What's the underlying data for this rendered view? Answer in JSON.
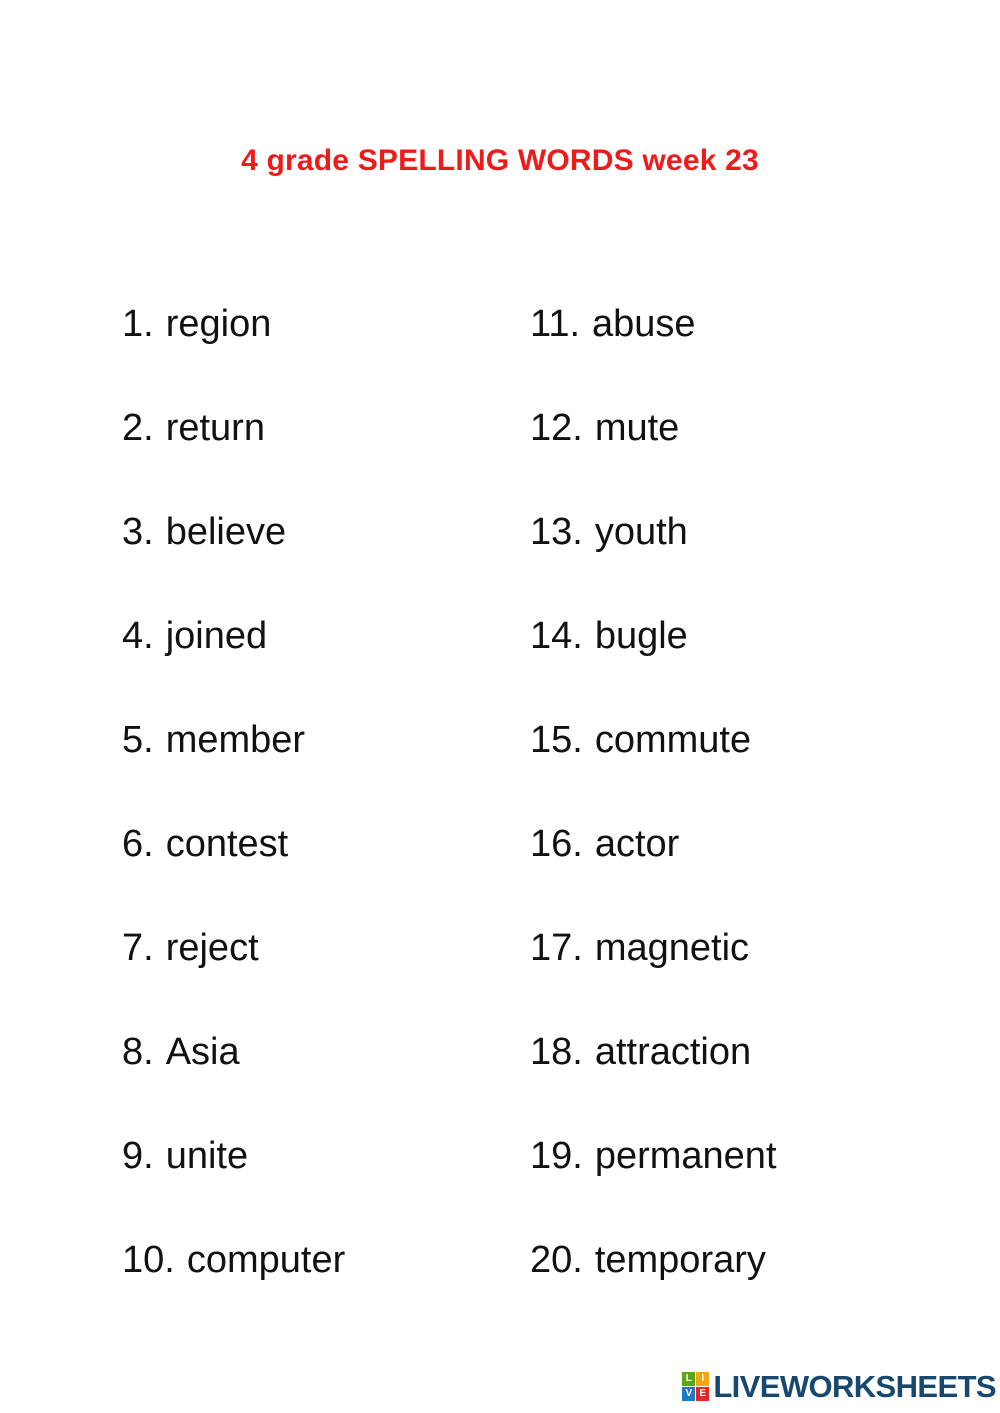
{
  "page": {
    "background_color": "#ffffff",
    "title": "4 grade SPELLING WORDS week 23",
    "title_color": "#ee1b1b",
    "text_color": "#111111"
  },
  "word_list": {
    "left_column": [
      {
        "number": "1.",
        "word": "region"
      },
      {
        "number": "2.",
        "word": "return"
      },
      {
        "number": "3.",
        "word": "believe"
      },
      {
        "number": "4.",
        "word": "joined"
      },
      {
        "number": "5.",
        "word": "member"
      },
      {
        "number": "6.",
        "word": "contest"
      },
      {
        "number": "7.",
        "word": "reject"
      },
      {
        "number": "8.",
        "word": "Asia"
      },
      {
        "number": "9.",
        "word": "unite"
      },
      {
        "number": "10.",
        "word": "computer"
      }
    ],
    "right_column": [
      {
        "number": "11.",
        "word": "abuse"
      },
      {
        "number": "12.",
        "word": "mute"
      },
      {
        "number": "13.",
        "word": "youth"
      },
      {
        "number": "14.",
        "word": "bugle"
      },
      {
        "number": "15.",
        "word": "commute"
      },
      {
        "number": "16.",
        "word": "actor"
      },
      {
        "number": "17.",
        "word": "magnetic"
      },
      {
        "number": "18.",
        "word": "attraction"
      },
      {
        "number": "19.",
        "word": "permanent"
      },
      {
        "number": "20.",
        "word": "temporary"
      }
    ]
  },
  "logo": {
    "wordmark": "LIVEWORKSHEETS",
    "wordmark_color": "#17486f",
    "mark_letters": [
      {
        "letter": "L",
        "color": "#59a616"
      },
      {
        "letter": "I",
        "color": "#f2a50c"
      },
      {
        "letter": "V",
        "color": "#1f7ac4"
      },
      {
        "letter": "E",
        "color": "#e8242a"
      }
    ]
  }
}
